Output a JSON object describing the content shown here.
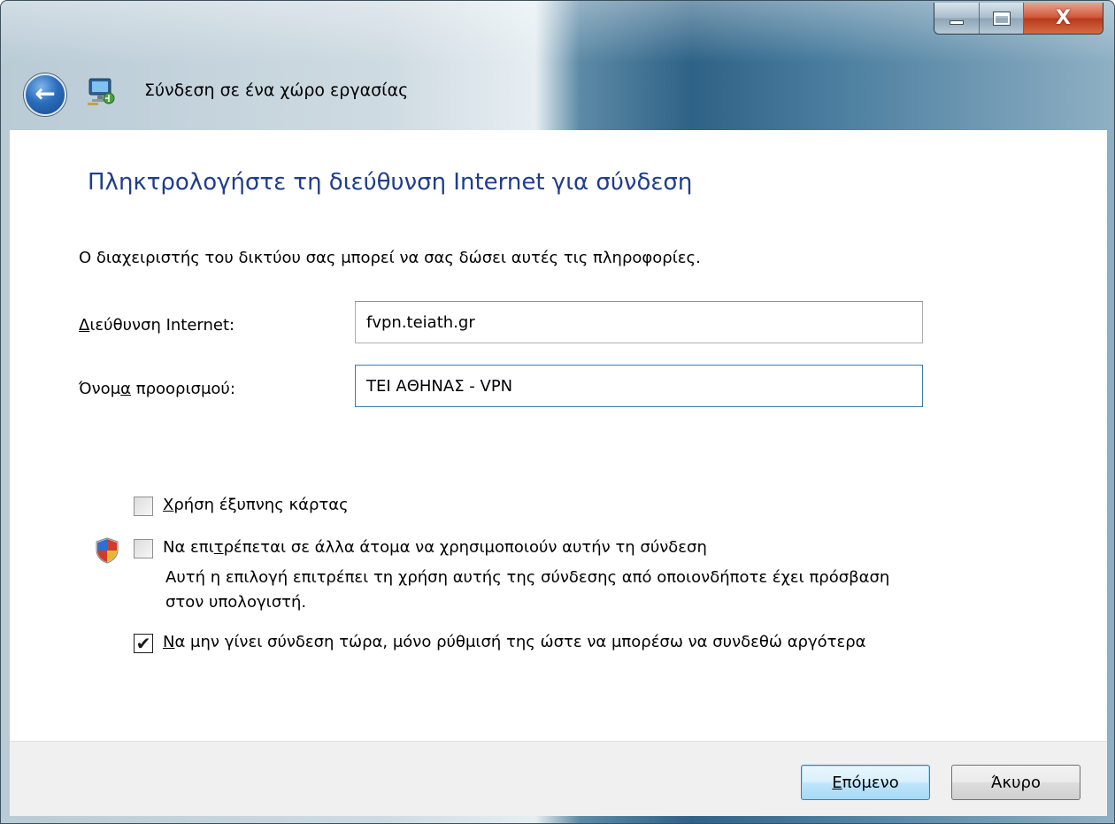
{
  "window": {
    "title": "Σύνδεση σε ένα χώρο εργασίας",
    "caption_buttons": {
      "minimize_icon": "minimize-icon",
      "maximize_icon": "maximize-icon",
      "close_icon": "close-icon",
      "close_glyph": "X"
    },
    "back_glyph": "←"
  },
  "page": {
    "heading": "Πληκτρολογήστε τη διεύθυνση Internet για σύνδεση",
    "description": "Ο διαχειριστής του δικτύου σας μπορεί να σας δώσει αυτές τις πληροφορίες."
  },
  "fields": {
    "internet_address": {
      "label_mnemonic": "Δ",
      "label_rest": "ιεύθυνση Internet:",
      "value": "fvpn.teiath.gr"
    },
    "destination_name": {
      "label_pre": "Όνομ",
      "label_mnemonic": "α",
      "label_post": " προορισμού:",
      "value": "ΤΕΙ ΑΘΗΝΑΣ - VPN"
    }
  },
  "options": {
    "smart_card": {
      "label_mnemonic": "Χ",
      "label_rest": "ρήση έξυπνης κάρτας",
      "checked": false
    },
    "allow_others": {
      "label_pre": "Να επι",
      "label_mnemonic": "τ",
      "label_post": "ρέπεται σε άλλα άτομα να χρησιμοποιούν αυτήν τη σύνδεση",
      "note_line1": "Αυτή η επιλογή επιτρέπει τη χρήση αυτής της σύνδεσης από οποιονδήποτε έχει πρόσβαση",
      "note_line2": "στον υπολογιστή.",
      "checked": false,
      "icon": "uac-shield-icon"
    },
    "dont_connect_now": {
      "label_mnemonic": "Ν",
      "label_rest": "α μην γίνει σύνδεση τώρα, μόνο ρύθμισή της ώστε να μπορέσω να συνδεθώ αργότερα",
      "checked": true,
      "check_glyph": "✔"
    }
  },
  "footer": {
    "next_mnemonic": "Ε",
    "next_rest": "πόμενο",
    "cancel_label": "Άκυρο"
  }
}
